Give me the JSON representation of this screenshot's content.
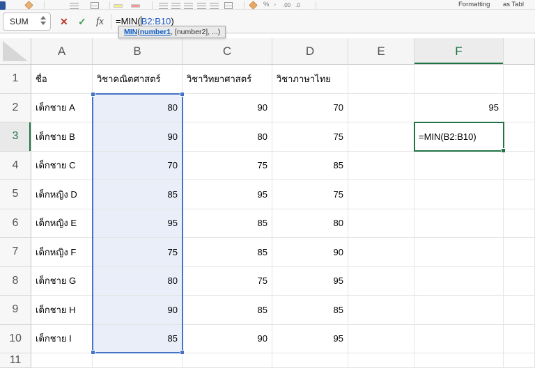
{
  "ribbon": {
    "formatting_label": "Formatting",
    "as_table_label": "as Tabl",
    "percent_label": "%",
    "chevron_label": "›",
    "increase_decimal_label": ".00",
    "decrease_decimal_label": ".0"
  },
  "formula_bar": {
    "name_box_value": "SUM",
    "cancel_label": "✕",
    "enter_label": "✓",
    "insert_function_label": "fx",
    "formula_prefix": "=MIN(",
    "formula_range": "B2:B10",
    "formula_suffix": ")"
  },
  "function_tooltip": {
    "function_name": "MIN",
    "paren": "(",
    "active_arg": "number1",
    "remaining_args": ", [number2], ...)"
  },
  "grid": {
    "column_headers": [
      "A",
      "B",
      "C",
      "D",
      "E",
      "F"
    ],
    "active_column": "F",
    "active_row": "3",
    "selected_range": "B2:B10",
    "selection_fill_color": "#e9eef8",
    "selection_border_color": "#4472c4",
    "active_cell_border_color": "#217346"
  },
  "sheet": {
    "rows": [
      {
        "n": "1",
        "a": "ชื่อ",
        "b": "วิชาคณิตศาสตร์",
        "c": "วิชาวิทยาศาสตร์",
        "d": "วิชาภาษาไทย"
      },
      {
        "n": "2",
        "a": "เด็กชาย A",
        "b": "80",
        "c": "90",
        "d": "70",
        "f": "95"
      },
      {
        "n": "3",
        "a": "เด็กชาย B",
        "b": "90",
        "c": "80",
        "d": "75",
        "f": "=MIN(B2:B10)"
      },
      {
        "n": "4",
        "a": "เด็กชาย C",
        "b": "70",
        "c": "75",
        "d": "85"
      },
      {
        "n": "5",
        "a": "เด็กหญิง D",
        "b": "85",
        "c": "95",
        "d": "75"
      },
      {
        "n": "6",
        "a": "เด็กหญิง E",
        "b": "95",
        "c": "85",
        "d": "80"
      },
      {
        "n": "7",
        "a": "เด็กหญิง F",
        "b": "75",
        "c": "85",
        "d": "90"
      },
      {
        "n": "8",
        "a": "เด็กชาย G",
        "b": "80",
        "c": "75",
        "d": "95"
      },
      {
        "n": "9",
        "a": "เด็กชาย H",
        "b": "90",
        "c": "85",
        "d": "85"
      },
      {
        "n": "10",
        "a": "เด็กชาย I",
        "b": "85",
        "c": "90",
        "d": "95"
      },
      {
        "n": "11"
      }
    ]
  }
}
